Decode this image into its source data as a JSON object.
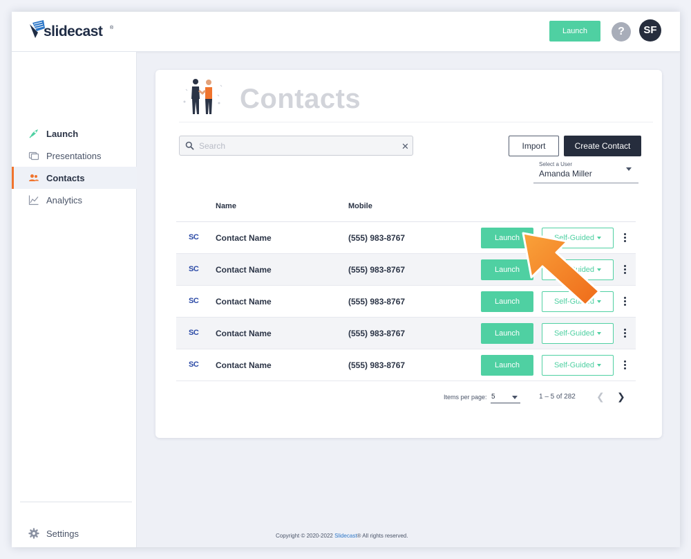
{
  "header": {
    "logo_text": "slidecast",
    "logo_mark": "®",
    "launch_label": "Launch",
    "help_label": "?",
    "avatar_initials": "SF"
  },
  "sidebar": {
    "items": [
      {
        "label": "Launch",
        "icon": "rocket-icon"
      },
      {
        "label": "Presentations",
        "icon": "slides-icon"
      },
      {
        "label": "Contacts",
        "icon": "people-icon",
        "active": true
      },
      {
        "label": "Analytics",
        "icon": "chart-icon"
      }
    ],
    "settings_label": "Settings"
  },
  "main": {
    "title": "Contacts",
    "search_placeholder": "Search",
    "search_value": "",
    "import_label": "Import",
    "create_label": "Create Contact",
    "user_select": {
      "label": "Select a User",
      "value": "Amanda Miller"
    },
    "table": {
      "columns": [
        "Name",
        "Mobile"
      ],
      "rows": [
        {
          "logo": "SC",
          "name": "Contact Name",
          "mobile": "(555) 983-8767",
          "launch": "Launch",
          "mode": "Self-Guided"
        },
        {
          "logo": "SC",
          "name": "Contact Name",
          "mobile": "(555) 983-8767",
          "launch": "Launch",
          "mode": "Self-Guided"
        },
        {
          "logo": "SC",
          "name": "Contact Name",
          "mobile": "(555) 983-8767",
          "launch": "Launch",
          "mode": "Self-Guided"
        },
        {
          "logo": "SC",
          "name": "Contact Name",
          "mobile": "(555) 983-8767",
          "launch": "Launch",
          "mode": "Self-Guided"
        },
        {
          "logo": "SC",
          "name": "Contact Name",
          "mobile": "(555) 983-8767",
          "launch": "Launch",
          "mode": "Self-Guided"
        }
      ]
    },
    "pagination": {
      "items_per_page_label": "Items per page:",
      "items_per_page": "5",
      "range": "1 – 5 of 282"
    }
  },
  "footer": {
    "prefix": "Copyright © 2020-2022",
    "brand": "Slidecast",
    "suffix": "® All rights reserved."
  },
  "colors": {
    "accent_green": "#4fd0a2",
    "dark": "#262d3d",
    "active_marker": "#f0742d",
    "arrow_orange": "#f7851e"
  }
}
